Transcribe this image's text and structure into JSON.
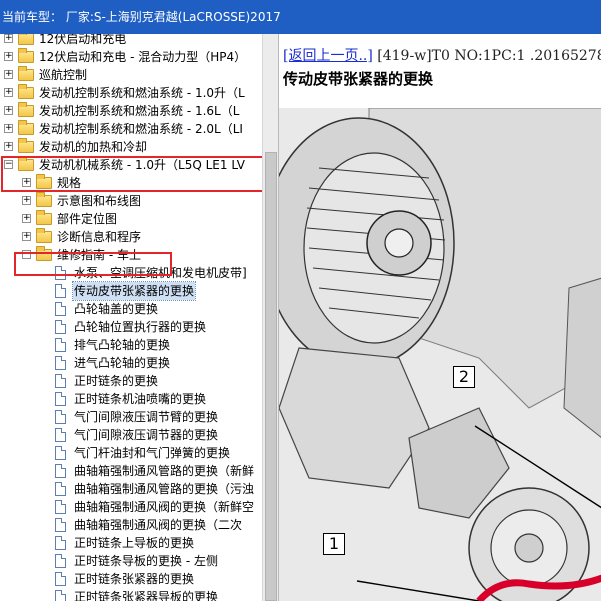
{
  "window": {
    "title": "当前车型：  厂家:S-上海别克君越(LaCROSSE)2017"
  },
  "tree": {
    "items": [
      {
        "label": "12伏启动和充电",
        "level": 0,
        "type": "folder",
        "expander": "+"
      },
      {
        "label": "12伏启动和充电 - 混合动力型（HP4）",
        "level": 0,
        "type": "folder",
        "expander": "+"
      },
      {
        "label": "巡航控制",
        "level": 0,
        "type": "folder",
        "expander": "+"
      },
      {
        "label": "发动机控制系统和燃油系统 - 1.0升（L",
        "level": 0,
        "type": "folder",
        "expander": "+"
      },
      {
        "label": "发动机控制系统和燃油系统 - 1.6L（L",
        "level": 0,
        "type": "folder",
        "expander": "+"
      },
      {
        "label": "发动机控制系统和燃油系统 - 2.0L（LI",
        "level": 0,
        "type": "folder",
        "expander": "+"
      },
      {
        "label": "发动机的加热和冷却",
        "level": 0,
        "type": "folder",
        "expander": "+"
      },
      {
        "label": "发动机机械系统 - 1.0升（L5Q LE1 LV",
        "level": 0,
        "type": "folder",
        "expander": "-"
      },
      {
        "label": "规格",
        "level": 1,
        "type": "folder",
        "expander": "+"
      },
      {
        "label": "示意图和布线图",
        "level": 1,
        "type": "folder",
        "expander": "+"
      },
      {
        "label": "部件定位图",
        "level": 1,
        "type": "folder",
        "expander": "+"
      },
      {
        "label": "诊断信息和程序",
        "level": 1,
        "type": "folder",
        "expander": "+"
      },
      {
        "label": "维修指南 - 车上",
        "level": 1,
        "type": "folder",
        "expander": "-"
      },
      {
        "label": "水泵、空调压缩机和发电机皮带]",
        "level": 2,
        "type": "doc"
      },
      {
        "label": "传动皮带张紧器的更换",
        "level": 2,
        "type": "doc",
        "selected": true
      },
      {
        "label": "凸轮轴盖的更换",
        "level": 2,
        "type": "doc"
      },
      {
        "label": "凸轮轴位置执行器的更换",
        "level": 2,
        "type": "doc"
      },
      {
        "label": "排气凸轮轴的更换",
        "level": 2,
        "type": "doc"
      },
      {
        "label": "进气凸轮轴的更换",
        "level": 2,
        "type": "doc"
      },
      {
        "label": "正时链条的更换",
        "level": 2,
        "type": "doc"
      },
      {
        "label": "正时链条机油喷嘴的更换",
        "level": 2,
        "type": "doc"
      },
      {
        "label": "气门间隙液压调节臂的更换",
        "level": 2,
        "type": "doc"
      },
      {
        "label": "气门间隙液压调节器的更换",
        "level": 2,
        "type": "doc"
      },
      {
        "label": "气门杆油封和气门弹簧的更换",
        "level": 2,
        "type": "doc"
      },
      {
        "label": "曲轴箱强制通风管路的更换（新鲜",
        "level": 2,
        "type": "doc"
      },
      {
        "label": "曲轴箱强制通风管路的更换（污浊",
        "level": 2,
        "type": "doc"
      },
      {
        "label": "曲轴箱强制通风阀的更换（新鲜空",
        "level": 2,
        "type": "doc"
      },
      {
        "label": "曲轴箱强制通风阀的更换（二次",
        "level": 2,
        "type": "doc"
      },
      {
        "label": "正时链条上导板的更换",
        "level": 2,
        "type": "doc"
      },
      {
        "label": "正时链条导板的更换 - 左侧",
        "level": 2,
        "type": "doc"
      },
      {
        "label": "正时链条张紧器的更换",
        "level": 2,
        "type": "doc"
      },
      {
        "label": "正时链条张紧器导板的更换",
        "level": 2,
        "type": "doc"
      }
    ]
  },
  "content": {
    "back_link": "[返回上一页..]",
    "doc_ref": " [419-w]T0 NO:1PC:1 .2016527877",
    "title": "传动皮带张紧器的更换",
    "callouts": [
      "2",
      "1"
    ]
  },
  "colors": {
    "titlebar": "#1f5fc4",
    "highlight": "#e3262a",
    "link": "#1a2dd0",
    "belt": "#d8002a"
  }
}
